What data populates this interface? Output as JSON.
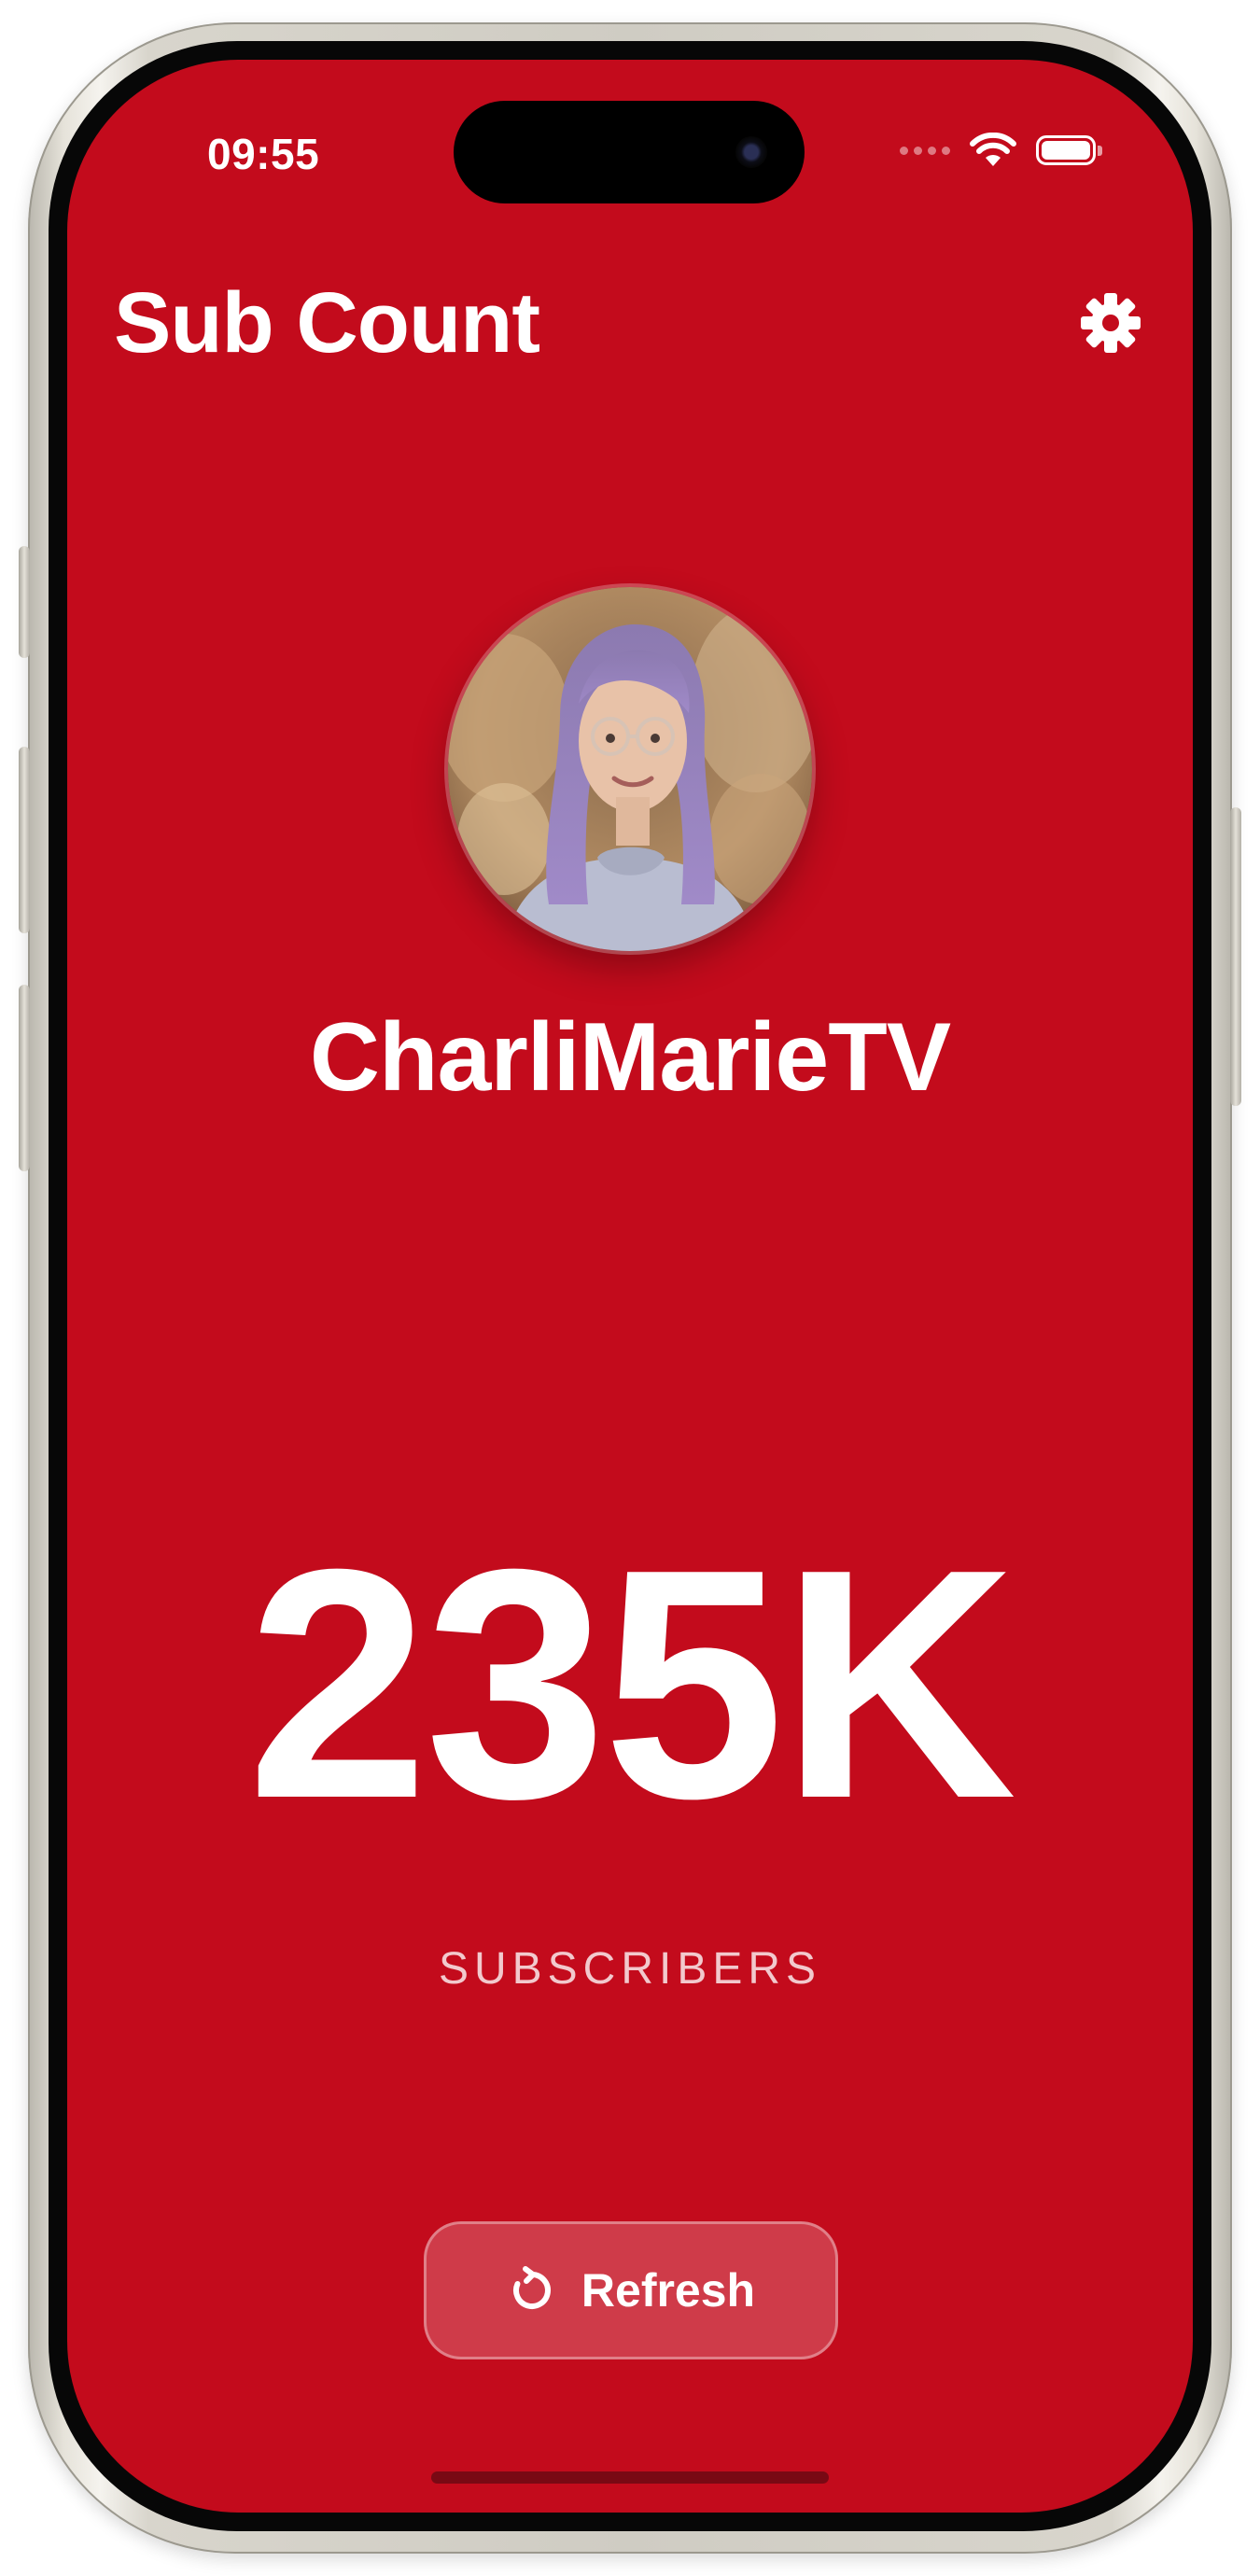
{
  "status_bar": {
    "time": "09:55",
    "signal_icon": "signal-dots-icon",
    "wifi_icon": "wifi-icon",
    "battery_icon": "battery-full-icon"
  },
  "header": {
    "title": "Sub Count",
    "settings_icon": "gear-icon"
  },
  "channel": {
    "name": "CharliMarieTV",
    "avatar": "channel-avatar-photo"
  },
  "stats": {
    "count": "235K",
    "label": "SUBSCRIBERS"
  },
  "actions": {
    "refresh_label": "Refresh",
    "refresh_icon": "refresh-icon"
  },
  "colors": {
    "background": "#c30b1c",
    "text": "#ffffff"
  }
}
